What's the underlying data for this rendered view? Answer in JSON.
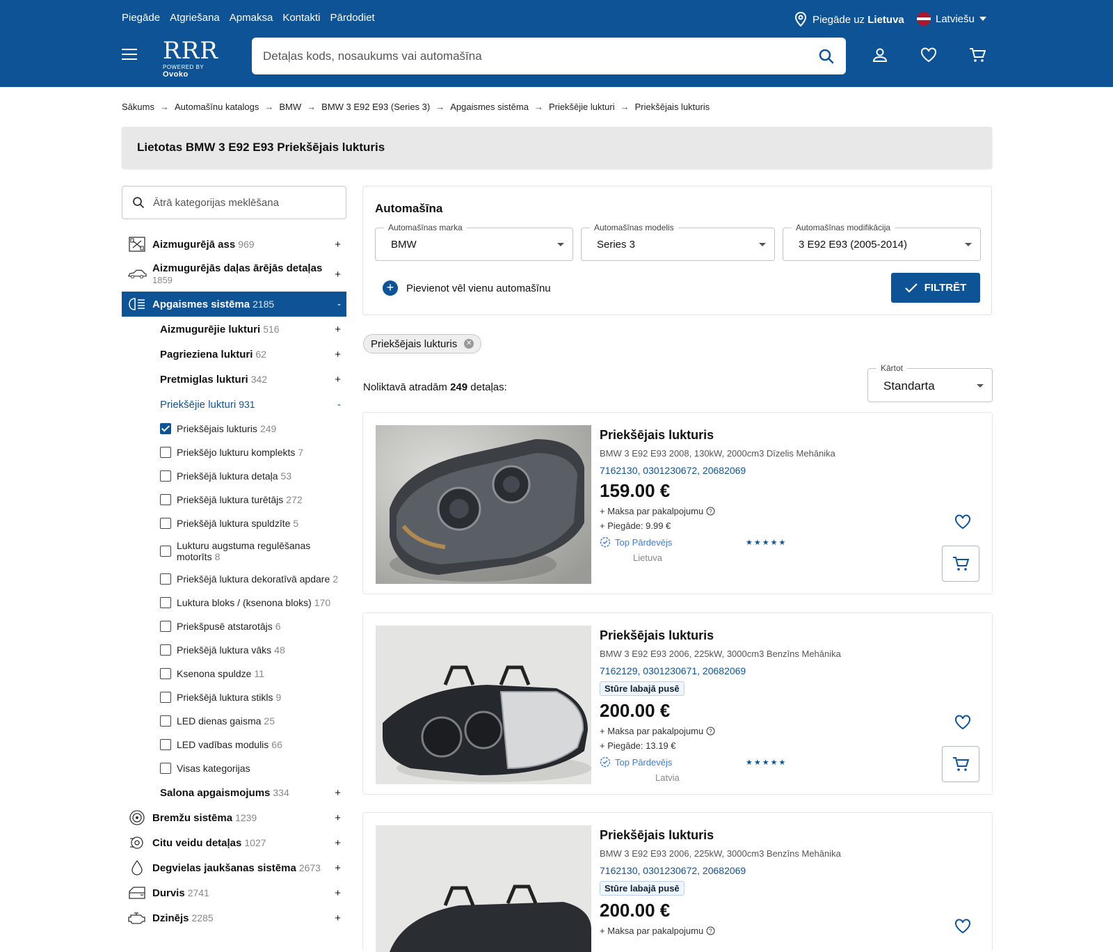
{
  "header": {
    "links": [
      "Piegāde",
      "Atgriešana",
      "Apmaksa",
      "Kontakti",
      "Pārdodiet"
    ],
    "ship_to_prefix": "Piegāde uz",
    "ship_to_country": "Lietuva",
    "language": "Latviešu",
    "logo_text": "RRR",
    "logo_powered": "POWERED BY",
    "logo_brand": "Ovoko",
    "search_placeholder": "Detaļas kods, nosaukums vai automašīna"
  },
  "breadcrumb": [
    "Sākums",
    "Automašīnu katalogs",
    "BMW",
    "BMW 3 E92 E93 (Series 3)",
    "Apgaismes sistēma",
    "Priekšējie lukturi",
    "Priekšējais lukturis"
  ],
  "page_title": "Lietotas BMW 3 E92 E93 Priekšējais lukturis",
  "sidebar": {
    "search_placeholder": "Ātrā kategorijas meklēšana",
    "top_categories": [
      {
        "label": "Aizmugurējā ass",
        "count": "969",
        "toggle": "+"
      },
      {
        "label": "Aizmugurējās daļas ārējās detaļas",
        "count": "1859",
        "toggle": "+"
      },
      {
        "label": "Apgaismes sistēma",
        "count": "2185",
        "toggle": "-"
      }
    ],
    "subcategories": [
      {
        "label": "Aizmugurējie lukturi",
        "count": "516",
        "toggle": "+"
      },
      {
        "label": "Pagrieziena lukturi",
        "count": "62",
        "toggle": "+"
      },
      {
        "label": "Pretmiglas lukturi",
        "count": "342",
        "toggle": "+"
      },
      {
        "label": "Priekšējie lukturi",
        "count": "931",
        "toggle": "-"
      }
    ],
    "leaves": [
      {
        "label": "Priekšējais lukturis",
        "count": "249",
        "checked": true
      },
      {
        "label": "Priekšējo lukturu komplekts",
        "count": "7"
      },
      {
        "label": "Priekšējā luktura detaļa",
        "count": "53"
      },
      {
        "label": "Priekšējā luktura turētājs",
        "count": "272"
      },
      {
        "label": "Priekšējā luktura spuldzīte",
        "count": "5"
      },
      {
        "label": "Lukturu augstuma regulēšanas motorīts",
        "count": "8"
      },
      {
        "label": "Priekšējā luktura dekoratīvā apdare",
        "count": "2"
      },
      {
        "label": "Luktura bloks / (ksenona bloks)",
        "count": "170"
      },
      {
        "label": "Priekšpusē atstarotājs",
        "count": "6"
      },
      {
        "label": "Priekšējā luktura vāks",
        "count": "48"
      },
      {
        "label": "Ksenona spuldze",
        "count": "11"
      },
      {
        "label": "Priekšējā luktura stikls",
        "count": "9"
      },
      {
        "label": "LED dienas gaisma",
        "count": "25"
      },
      {
        "label": "LED vadības modulis",
        "count": "66"
      },
      {
        "label": "Visas kategorijas",
        "count": ""
      }
    ],
    "after_sub": {
      "label": "Salona apgaismojums",
      "count": "334",
      "toggle": "+"
    },
    "bottom_categories": [
      {
        "label": "Bremžu sistēma",
        "count": "1239",
        "toggle": "+"
      },
      {
        "label": "Citu veidu detaļas",
        "count": "1027",
        "toggle": "+"
      },
      {
        "label": "Degvielas jaukšanas sistēma",
        "count": "2673",
        "toggle": "+"
      },
      {
        "label": "Durvis",
        "count": "2741",
        "toggle": "+"
      },
      {
        "label": "Dzinējs",
        "count": "2285",
        "toggle": "+"
      }
    ]
  },
  "car_filter": {
    "title": "Automašīna",
    "make_label": "Automašīnas marka",
    "make_value": "BMW",
    "model_label": "Automašīnas modelis",
    "model_value": "Series 3",
    "mod_label": "Automašīnas modifikācija",
    "mod_value": "3 E92 E93 (2005-2014)",
    "add_car": "Pievienot vēl vienu automašīnu",
    "filter_button": "FILTRĒT"
  },
  "active_chip": "Priekšējais lukturis",
  "results": {
    "prefix": "Noliktavā atradām",
    "count": "249",
    "suffix": "detaļas:",
    "sort_label": "Kārtot",
    "sort_value": "Standarta"
  },
  "products": [
    {
      "title": "Priekšējais lukturis",
      "desc": "BMW 3 E92 E93 2008, 130kW, 2000cm3 Dīzelis Mehānika",
      "codes": "7162130, 0301230672, 20682069",
      "side": "",
      "price": "159.00 €",
      "fee": "+ Maksa par pakalpojumu",
      "shipping": "+ Piegāde: 9.99 €",
      "seller": "Top Pārdevējs",
      "stars": "★★★★★",
      "country": "Lietuva"
    },
    {
      "title": "Priekšējais lukturis",
      "desc": "BMW 3 E92 E93 2006, 225kW, 3000cm3 Benzīns Mehānika",
      "codes": "7162129, 0301230671, 20682069",
      "side": "Stūre labajā pusē",
      "price": "200.00 €",
      "fee": "+ Maksa par pakalpojumu",
      "shipping": "+ Piegāde: 13.19 €",
      "seller": "Top Pārdevējs",
      "stars": "★★★★★",
      "country": "Latvia"
    },
    {
      "title": "Priekšējais lukturis",
      "desc": "BMW 3 E92 E93 2006, 225kW, 3000cm3 Benzīns Mehānika",
      "codes": "7162130, 0301230672, 20682069",
      "side": "Stūre labajā pusē",
      "price": "200.00 €",
      "fee": "+ Maksa par pakalpojumu"
    }
  ],
  "colors": {
    "brand": "#0e5396",
    "accent_link": "#3a7be0"
  }
}
